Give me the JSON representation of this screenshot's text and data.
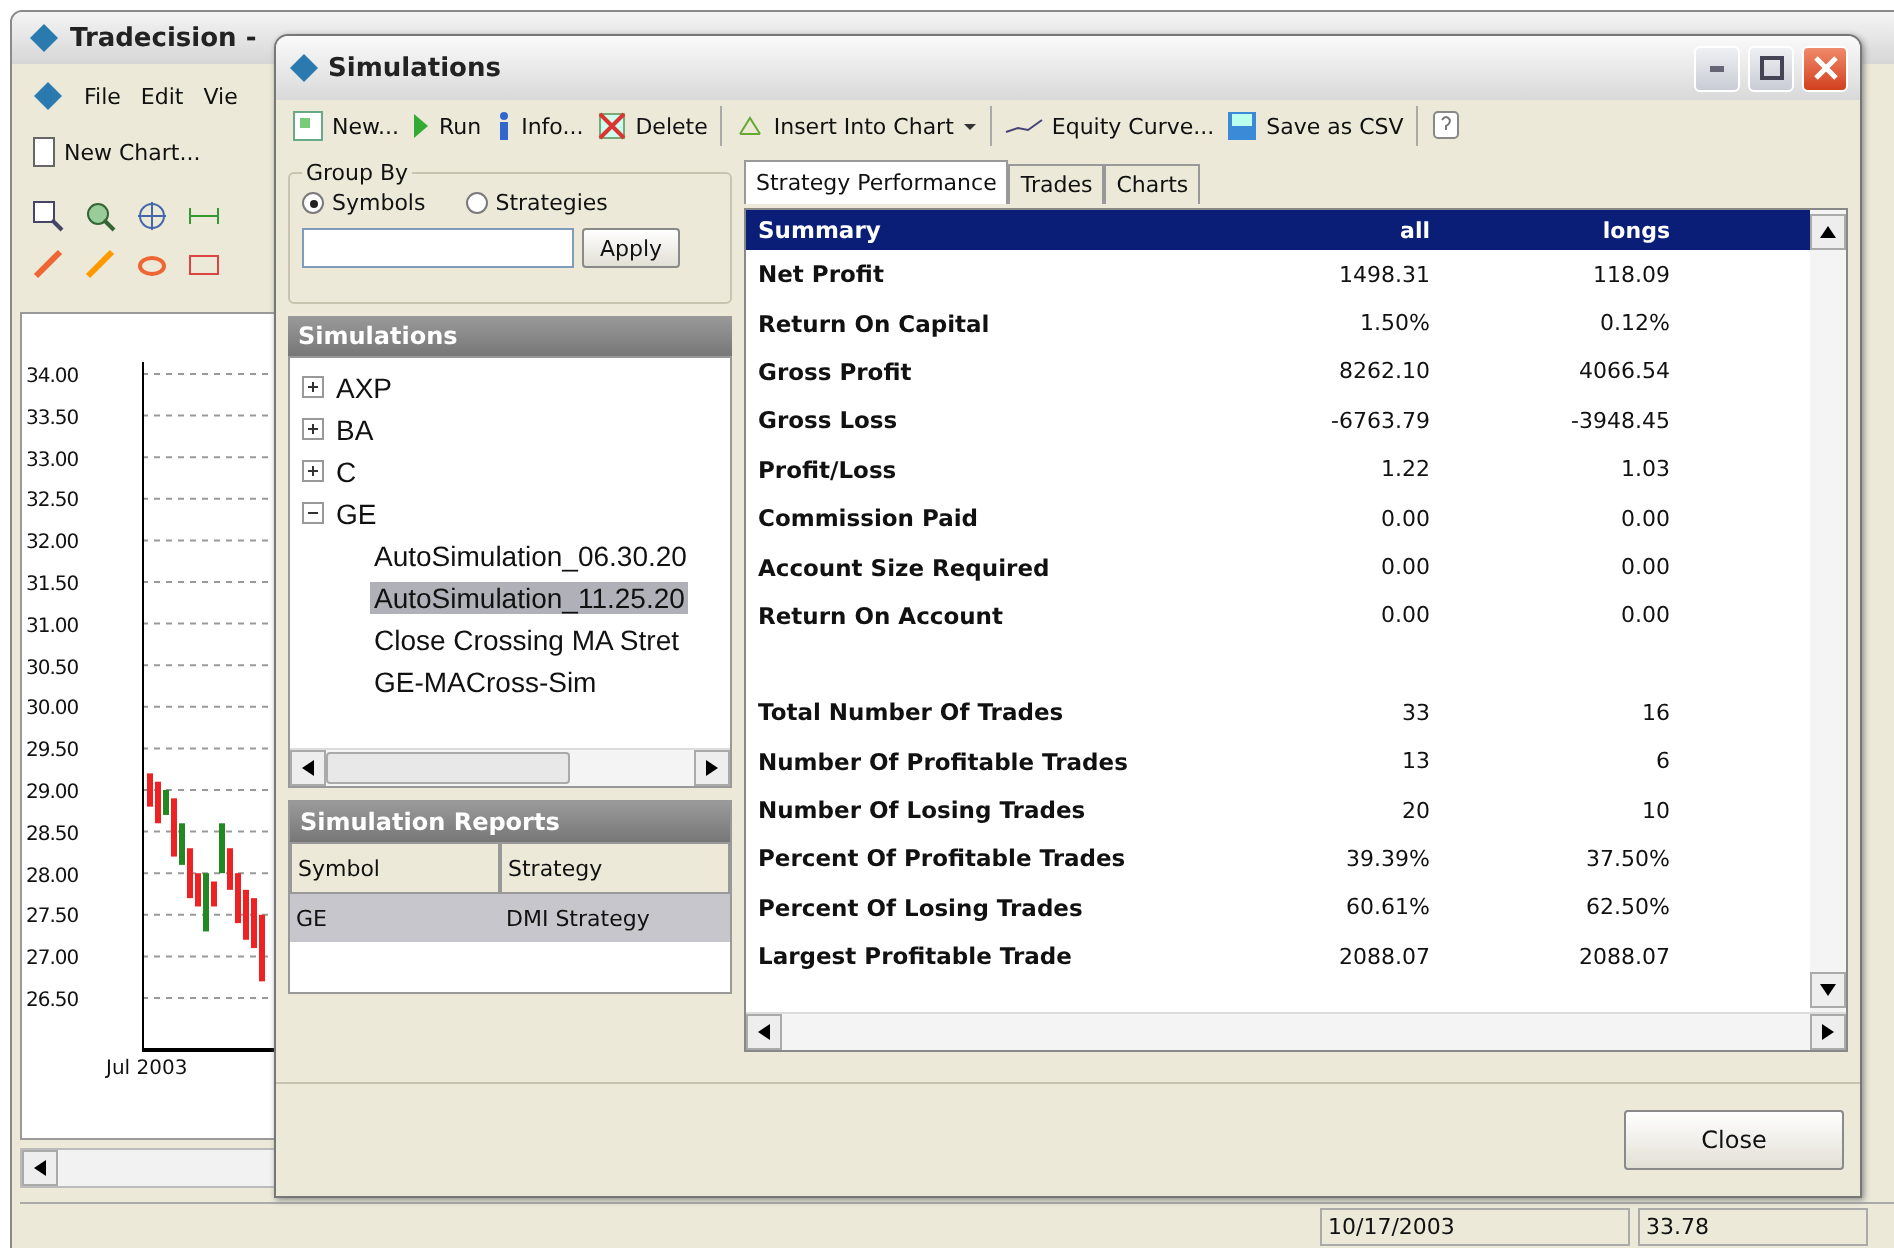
{
  "main_window": {
    "title": "Tradecision -",
    "menu": [
      "File",
      "Edit",
      "Vie"
    ],
    "toolbar": [
      "New Chart..."
    ],
    "chart": {
      "price_ticks": [
        "34.00",
        "33.50",
        "33.00",
        "32.50",
        "32.00",
        "31.50",
        "31.00",
        "30.50",
        "30.00",
        "29.50",
        "29.00",
        "28.50",
        "28.00",
        "27.50",
        "27.00",
        "26.50"
      ],
      "date_label": "Jul 2003"
    },
    "status_bar": [
      "10/17/2003",
      "33.78"
    ]
  },
  "dialog": {
    "title": "Simulations",
    "toolbar": [
      {
        "kind": "new",
        "label": "New...",
        "separator_before": false,
        "dropdown": false
      },
      {
        "kind": "run",
        "label": "Run",
        "separator_before": false,
        "dropdown": false
      },
      {
        "kind": "info",
        "label": "Info...",
        "separator_before": false,
        "dropdown": false
      },
      {
        "kind": "delete",
        "label": "Delete",
        "separator_before": false,
        "dropdown": false
      },
      {
        "kind": "insert",
        "label": "Insert Into Chart",
        "separator_before": true,
        "dropdown": true
      },
      {
        "kind": "equity",
        "label": "Equity Curve...",
        "separator_before": true,
        "dropdown": false
      },
      {
        "kind": "save",
        "label": "Save as CSV",
        "separator_before": false,
        "dropdown": false
      },
      {
        "kind": "help",
        "separator_before": true,
        "dropdown": false
      }
    ],
    "group_by": {
      "legend": "Group By",
      "options": [
        {
          "label": "Symbols",
          "selected": true
        },
        {
          "label": "Strategies",
          "selected": false
        }
      ],
      "button": "Apply"
    },
    "simulations": {
      "title": "Simulations",
      "tree": [
        {
          "label": "AXP",
          "expanded": false
        },
        {
          "label": "BA",
          "expanded": false
        },
        {
          "label": "C",
          "expanded": false
        },
        {
          "label": "GE",
          "expanded": true,
          "children": [
            {
              "label": "AutoSimulation_06.30.20",
              "selected": false
            },
            {
              "label": "AutoSimulation_11.25.20",
              "selected": true
            },
            {
              "label": "Close Crossing MA Stret",
              "selected": false
            },
            {
              "label": "GE-MACross-Sim",
              "selected": false
            }
          ]
        }
      ]
    },
    "reports": {
      "title": "Simulation Reports",
      "columns": [
        "Symbol",
        "Strategy"
      ],
      "rows": [
        {
          "cells": [
            "GE",
            "DMI Strategy"
          ],
          "selected": true
        }
      ]
    },
    "tabs": [
      {
        "label": "Strategy Performance",
        "selected": true
      },
      {
        "label": "Trades",
        "selected": false
      },
      {
        "label": "Charts",
        "selected": false
      }
    ],
    "performance": {
      "columns": [
        "Summary",
        "all",
        "longs"
      ],
      "groups": [
        [
          {
            "label": "Net Profit",
            "values": [
              "1498.31",
              "118.09"
            ]
          },
          {
            "label": "Return On Capital",
            "values": [
              "1.50%",
              "0.12%"
            ]
          },
          {
            "label": "Gross Profit",
            "values": [
              "8262.10",
              "4066.54"
            ]
          },
          {
            "label": "Gross Loss",
            "values": [
              "-6763.79",
              "-3948.45"
            ]
          },
          {
            "label": "Profit/Loss",
            "values": [
              "1.22",
              "1.03"
            ]
          },
          {
            "label": "Commission Paid",
            "values": [
              "0.00",
              "0.00"
            ]
          },
          {
            "label": "Account Size Required",
            "values": [
              "0.00",
              "0.00"
            ]
          },
          {
            "label": "Return On Account",
            "values": [
              "0.00",
              "0.00"
            ]
          }
        ],
        [
          {
            "label": "Total Number Of Trades",
            "values": [
              "33",
              "16"
            ]
          },
          {
            "label": "Number Of Profitable Trades",
            "values": [
              "13",
              "6"
            ]
          },
          {
            "label": "Number Of Losing Trades",
            "values": [
              "20",
              "10"
            ]
          },
          {
            "label": "Percent Of Profitable Trades",
            "values": [
              "39.39%",
              "37.50%"
            ]
          },
          {
            "label": "Percent Of Losing Trades",
            "values": [
              "60.61%",
              "62.50%"
            ]
          },
          {
            "label": "Largest Profitable Trade",
            "values": [
              "2088.07",
              "2088.07"
            ]
          }
        ]
      ]
    },
    "close_button": "Close"
  }
}
